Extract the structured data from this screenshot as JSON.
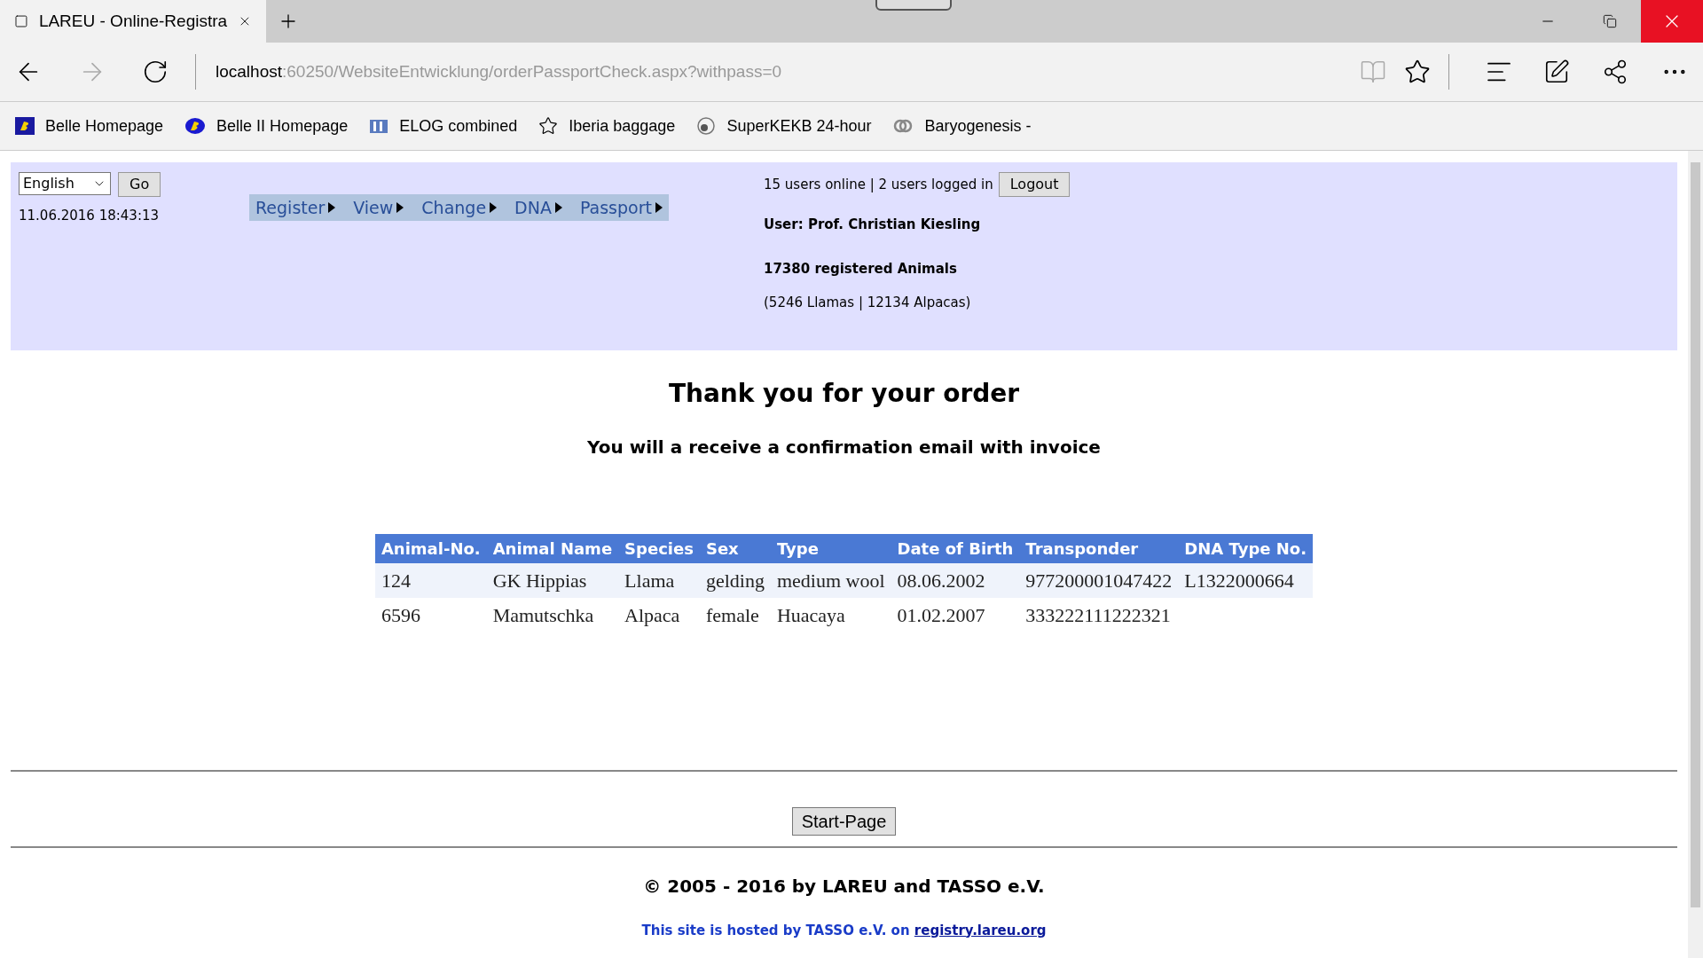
{
  "browser": {
    "tab_title": "LAREU - Online-Registra",
    "address_host": "localhost",
    "address_path": ":60250/WebsiteEntwicklung/orderPassportCheck.aspx?withpass=0",
    "favorites": [
      {
        "label": "Belle Homepage",
        "kind": "belle"
      },
      {
        "label": "Belle II Homepage",
        "kind": "belle2"
      },
      {
        "label": "ELOG combined",
        "kind": "elog"
      },
      {
        "label": "Iberia baggage",
        "kind": "star"
      },
      {
        "label": "SuperKEKB 24-hour",
        "kind": "kekb"
      },
      {
        "label": "Baryogenesis -",
        "kind": "rings"
      }
    ]
  },
  "header": {
    "language": "English",
    "go_button": "Go",
    "datetime": "11.06.2016 18:43:13",
    "menu": [
      "Register",
      "View",
      "Change",
      "DNA",
      "Passport"
    ],
    "online_status": "15 users online | 2 users logged in",
    "logout_button": "Logout",
    "user": "User: Prof. Christian Kiesling",
    "registered": "17380 registered Animals",
    "breakdown": "(5246 Llamas | 12134 Alpacas)"
  },
  "heading": "Thank you for your order",
  "subheading": "You will a receive a confirmation email with invoice",
  "table": {
    "columns": [
      "Animal-No.",
      "Animal Name",
      "Species",
      "Sex",
      "Type",
      "Date of Birth",
      "Transponder",
      "DNA Type No."
    ],
    "rows": [
      [
        "124",
        "GK Hippias",
        "Llama",
        "gelding",
        "medium wool",
        "08.06.2002",
        "977200001047422",
        "L1322000664"
      ],
      [
        "6596",
        "Mamutschka",
        "Alpaca",
        "female",
        "Huacaya",
        "01.02.2007",
        "333222111222321"
      ]
    ]
  },
  "start_button": "Start-Page",
  "copyright": "© 2005 - 2016 by LAREU and TASSO e.V.",
  "hosted": {
    "text": "This site is hosted by TASSO e.V. on",
    "link": "registry.lareu.org"
  }
}
